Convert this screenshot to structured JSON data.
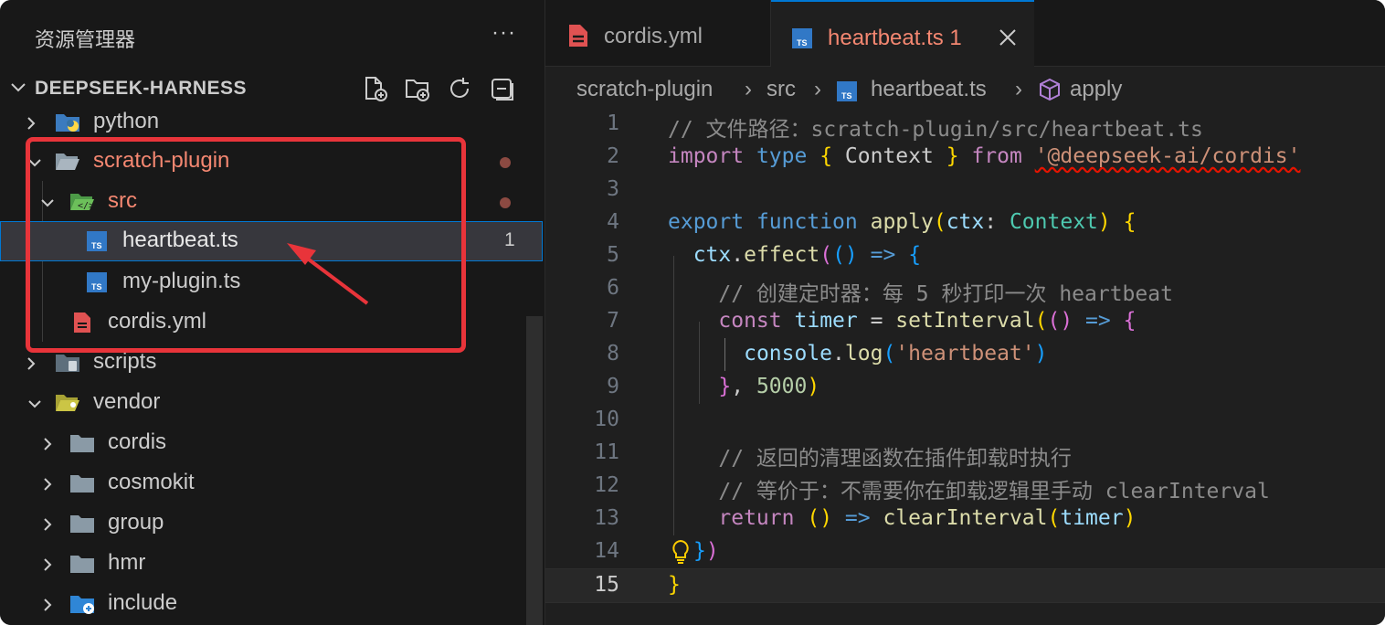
{
  "sidebar": {
    "title": "资源管理器",
    "more": "···",
    "root_label": "DEEPSEEK-HARNESS",
    "items": [
      {
        "label": "python"
      },
      {
        "label": "scratch-plugin"
      },
      {
        "label": "src"
      },
      {
        "label": "heartbeat.ts",
        "badge": "1"
      },
      {
        "label": "my-plugin.ts"
      },
      {
        "label": "cordis.yml"
      },
      {
        "label": "scripts"
      },
      {
        "label": "vendor"
      },
      {
        "label": "cordis"
      },
      {
        "label": "cosmokit"
      },
      {
        "label": "group"
      },
      {
        "label": "hmr"
      },
      {
        "label": "include"
      }
    ]
  },
  "tabs": [
    {
      "label": "cordis.yml"
    },
    {
      "label": "heartbeat.ts 1"
    }
  ],
  "breadcrumb": [
    "scratch-plugin",
    "src",
    "heartbeat.ts",
    "apply"
  ],
  "editor": {
    "line_numbers": [
      "1",
      "2",
      "3",
      "4",
      "5",
      "6",
      "7",
      "8",
      "9",
      "10",
      "11",
      "12",
      "13",
      "14",
      "15"
    ],
    "lines": [
      "// 文件路径：scratch-plugin/src/heartbeat.ts",
      "import type { Context } from '@deepseek-ai/cordis'",
      "",
      "export function apply(ctx: Context) {",
      "  ctx.effect(() => {",
      "    // 创建定时器：每 5 秒打印一次 heartbeat",
      "    const timer = setInterval(() => {",
      "      console.log('heartbeat')",
      "    }, 5000)",
      "",
      "    // 返回的清理函数在插件卸载时执行",
      "    // 等价于：不需要你在卸载逻辑里手动 clearInterval",
      "    return () => clearInterval(timer)",
      "  })",
      "}"
    ]
  },
  "colors": {
    "accent": "#0078d4",
    "annotation": "#e8343a",
    "modified_label": "#f48771"
  }
}
